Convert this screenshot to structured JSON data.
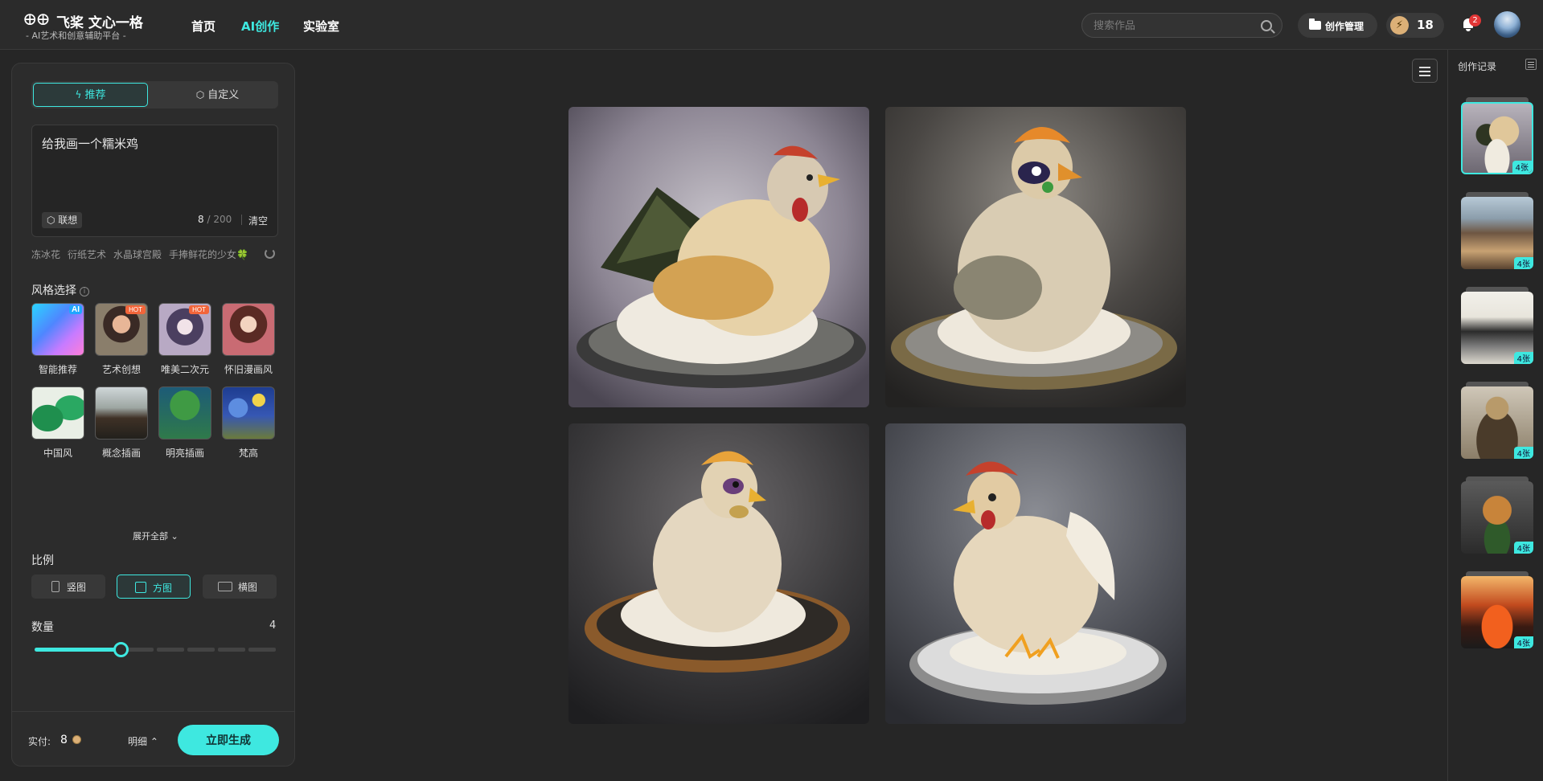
{
  "header": {
    "logo_mark": "⊕⊕",
    "logo_name": "飞桨 文心一格",
    "logo_sub": "- AI艺术和创意辅助平台 -",
    "nav": [
      "首页",
      "AI创作",
      "实验室"
    ],
    "nav_active": "AI创作",
    "search_placeholder": "搜索作品",
    "manage_label": "创作管理",
    "credits": "18",
    "bolt": "⚡",
    "notifications": "2"
  },
  "panel": {
    "tabs": {
      "recommend": "推荐",
      "custom": "自定义"
    },
    "prompt": "给我画一个糯米鸡",
    "assoc_label": "联想",
    "char_count": "8",
    "char_max": "/ 200",
    "clear_label": "清空",
    "suggestions": [
      "冻冰花",
      "衍纸艺术",
      "水晶球宫殿",
      "手捧鲜花的少女🍀"
    ],
    "style_title": "风格选择",
    "styles": [
      {
        "name": "智能推荐",
        "badge": "AI"
      },
      {
        "name": "艺术创想",
        "badge": "HOT"
      },
      {
        "name": "唯美二次元",
        "badge": "HOT"
      },
      {
        "name": "怀旧漫画风",
        "badge": ""
      },
      {
        "name": "中国风",
        "badge": ""
      },
      {
        "name": "概念插画",
        "badge": ""
      },
      {
        "name": "明亮插画",
        "badge": ""
      },
      {
        "name": "梵高",
        "badge": ""
      }
    ],
    "expand_label": "展开全部 ⌄",
    "ratio_title": "比例",
    "ratios": [
      "竖图",
      "方图",
      "横图"
    ],
    "ratio_selected": "方图",
    "qty_title": "数量",
    "qty_value": 4,
    "qty_max": 9,
    "pay_label": "实付:",
    "pay_amount": "8",
    "detail_label": "明细 ⌃",
    "generate_label": "立即生成"
  },
  "results": [
    {
      "desc": "zongzi-rice-chicken-on-plate"
    },
    {
      "desc": "rice-chicken-with-feathers"
    },
    {
      "desc": "rice-chicken-on-bronze-plate"
    },
    {
      "desc": "rice-chicken-standing-on-plate"
    }
  ],
  "history": {
    "title": "创作记录",
    "items": [
      {
        "count": "4张",
        "theme": "chicken"
      },
      {
        "count": "4张",
        "theme": "street"
      },
      {
        "count": "4张",
        "theme": "ink-street"
      },
      {
        "count": "4张",
        "theme": "tiger-man"
      },
      {
        "count": "4张",
        "theme": "tiger"
      },
      {
        "count": "4张",
        "theme": "volcano"
      }
    ]
  },
  "colors": {
    "accent": "#3ee8e0",
    "background": "#262626",
    "panel": "#2c2c2c"
  }
}
